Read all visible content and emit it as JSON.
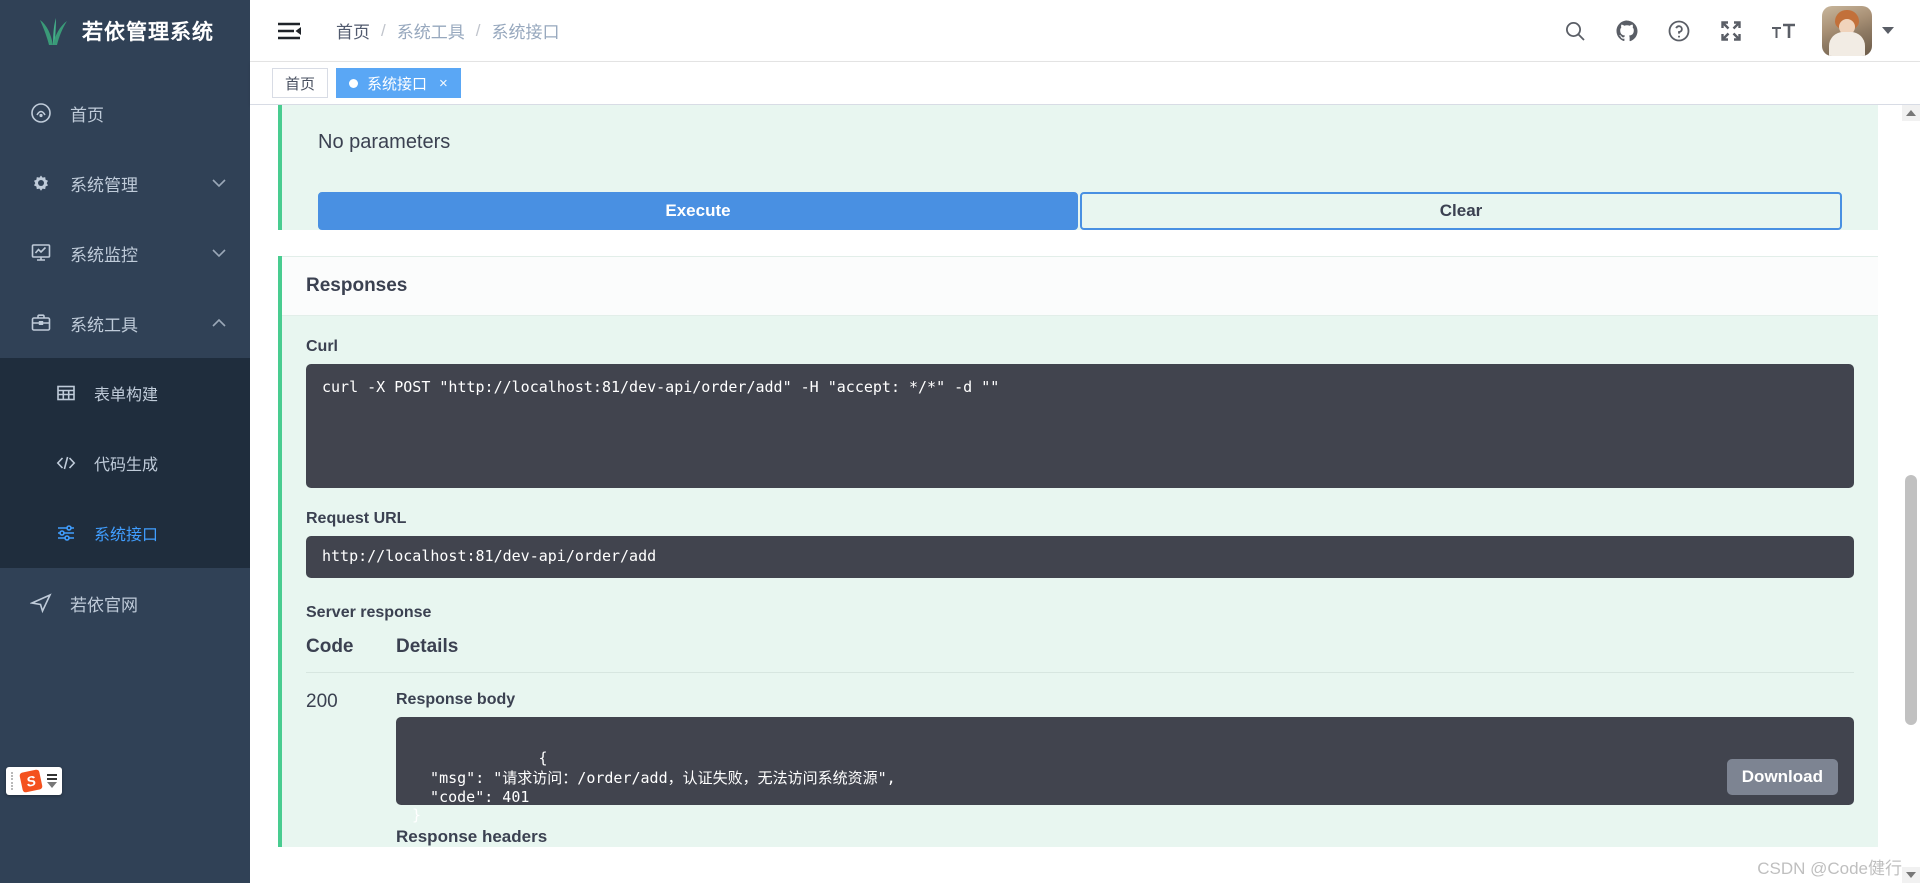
{
  "sidebar": {
    "logo_text": "若依管理系统",
    "logo_icon": "grass-logo-icon",
    "items": [
      {
        "label": "首页",
        "icon": "dashboard-icon",
        "expandable": false,
        "active": false
      },
      {
        "label": "系统管理",
        "icon": "gear-icon",
        "expandable": true,
        "active": false
      },
      {
        "label": "系统监控",
        "icon": "monitor-icon",
        "expandable": true,
        "active": false
      },
      {
        "label": "系统工具",
        "icon": "briefcase-icon",
        "expandable": true,
        "active": true
      }
    ],
    "submenu": [
      {
        "label": "表单构建",
        "icon": "table-icon",
        "active": false
      },
      {
        "label": "代码生成",
        "icon": "code-icon",
        "active": false
      },
      {
        "label": "系统接口",
        "icon": "sliders-icon",
        "active": true
      }
    ],
    "footer_item": {
      "label": "若依官网",
      "icon": "paper-plane-icon"
    },
    "active_color": "#409eff"
  },
  "header": {
    "hamburger_icon": "hamburger-icon",
    "breadcrumb": [
      "首页",
      "系统工具",
      "系统接口"
    ],
    "breadcrumb_separator": "/",
    "icons": [
      "search-icon",
      "github-icon",
      "help-icon",
      "fullscreen-icon",
      "font-size-icon"
    ],
    "avatar": "user-avatar",
    "caret_icon": "chevron-down-icon"
  },
  "tags": [
    {
      "label": "首页",
      "active": false,
      "closable": false
    },
    {
      "label": "系统接口",
      "active": true,
      "closable": true,
      "close_glyph": "×"
    }
  ],
  "main": {
    "no_parameters": "No parameters",
    "execute_label": "Execute",
    "clear_label": "Clear",
    "responses_title": "Responses",
    "curl_label": "Curl",
    "curl_command": "curl -X POST \"http://localhost:81/dev-api/order/add\" -H \"accept: */*\" -d \"\"",
    "request_url_label": "Request URL",
    "request_url": "http://localhost:81/dev-api/order/add",
    "server_response_label": "Server response",
    "table_headers": {
      "code": "Code",
      "details": "Details"
    },
    "rows": [
      {
        "code": "200",
        "response_body_label": "Response body",
        "response_body": "{\n  \"msg\": \"请求访问：/order/add，认证失败，无法访问系统资源\",\n  \"code\": 401\n}",
        "download_label": "Download",
        "response_headers_label": "Response headers"
      }
    ]
  },
  "ime": {
    "name": "sogou-input-badge",
    "glyph": "S"
  },
  "watermark": "CSDN @Code健行",
  "scrollbar": {
    "name": "vertical-scrollbar"
  }
}
